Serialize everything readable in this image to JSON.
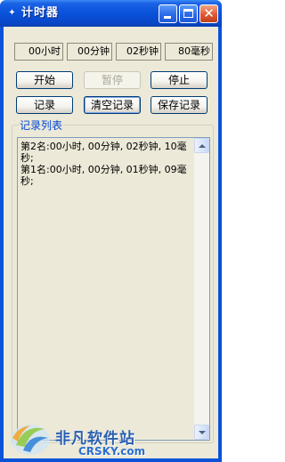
{
  "window": {
    "title": "计时器",
    "accent": "#0a54dc"
  },
  "counters": [
    "00小时",
    "00分钟",
    "02秒钟",
    "80毫秒"
  ],
  "buttons": {
    "start": "开始",
    "pause": "暂停",
    "stop": "停止",
    "record": "记录",
    "clear": "清空记录",
    "save": "保存记录"
  },
  "records": {
    "label": "记录列表",
    "text": "第2名:00小时, 00分钟, 02秒钟, 10毫秒;\n第1名:00小时, 00分钟, 01秒钟, 09毫秒;"
  },
  "watermark": {
    "name": "非凡软件站",
    "site": "CRSKY.com"
  }
}
